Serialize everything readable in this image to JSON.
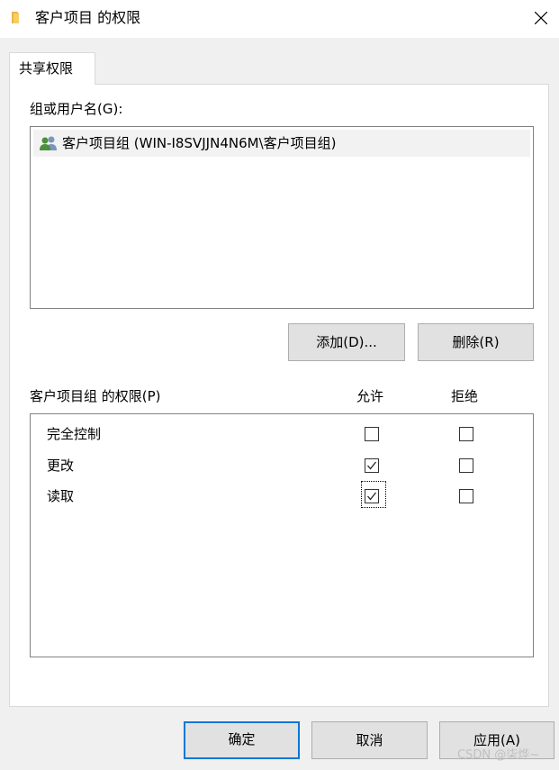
{
  "window": {
    "title": "客户项目 的权限",
    "close_icon": "close-icon",
    "folder_icon": "folder-icon"
  },
  "tab": {
    "label": "共享权限"
  },
  "groups": {
    "label": "组或用户名(G):",
    "items": [
      {
        "icon": "users-icon",
        "label": "客户项目组 (WIN-I8SVJJN4N6M\\客户项目组)"
      }
    ]
  },
  "buttons": {
    "add": "添加(D)...",
    "remove": "删除(R)"
  },
  "permissions": {
    "label": "客户项目组 的权限(P)",
    "allow_header": "允许",
    "deny_header": "拒绝",
    "rows": [
      {
        "name": "完全控制",
        "allow": false,
        "deny": false
      },
      {
        "name": "更改",
        "allow": true,
        "deny": false
      },
      {
        "name": "读取",
        "allow": true,
        "deny": false
      }
    ]
  },
  "footer": {
    "ok": "确定",
    "cancel": "取消",
    "apply": "应用(A)"
  },
  "watermark": "CSDN @柒烨~",
  "colors": {
    "focus_border": "#0078d7",
    "button_bg": "#e1e1e1",
    "folder_yellow": "#f0c040"
  }
}
